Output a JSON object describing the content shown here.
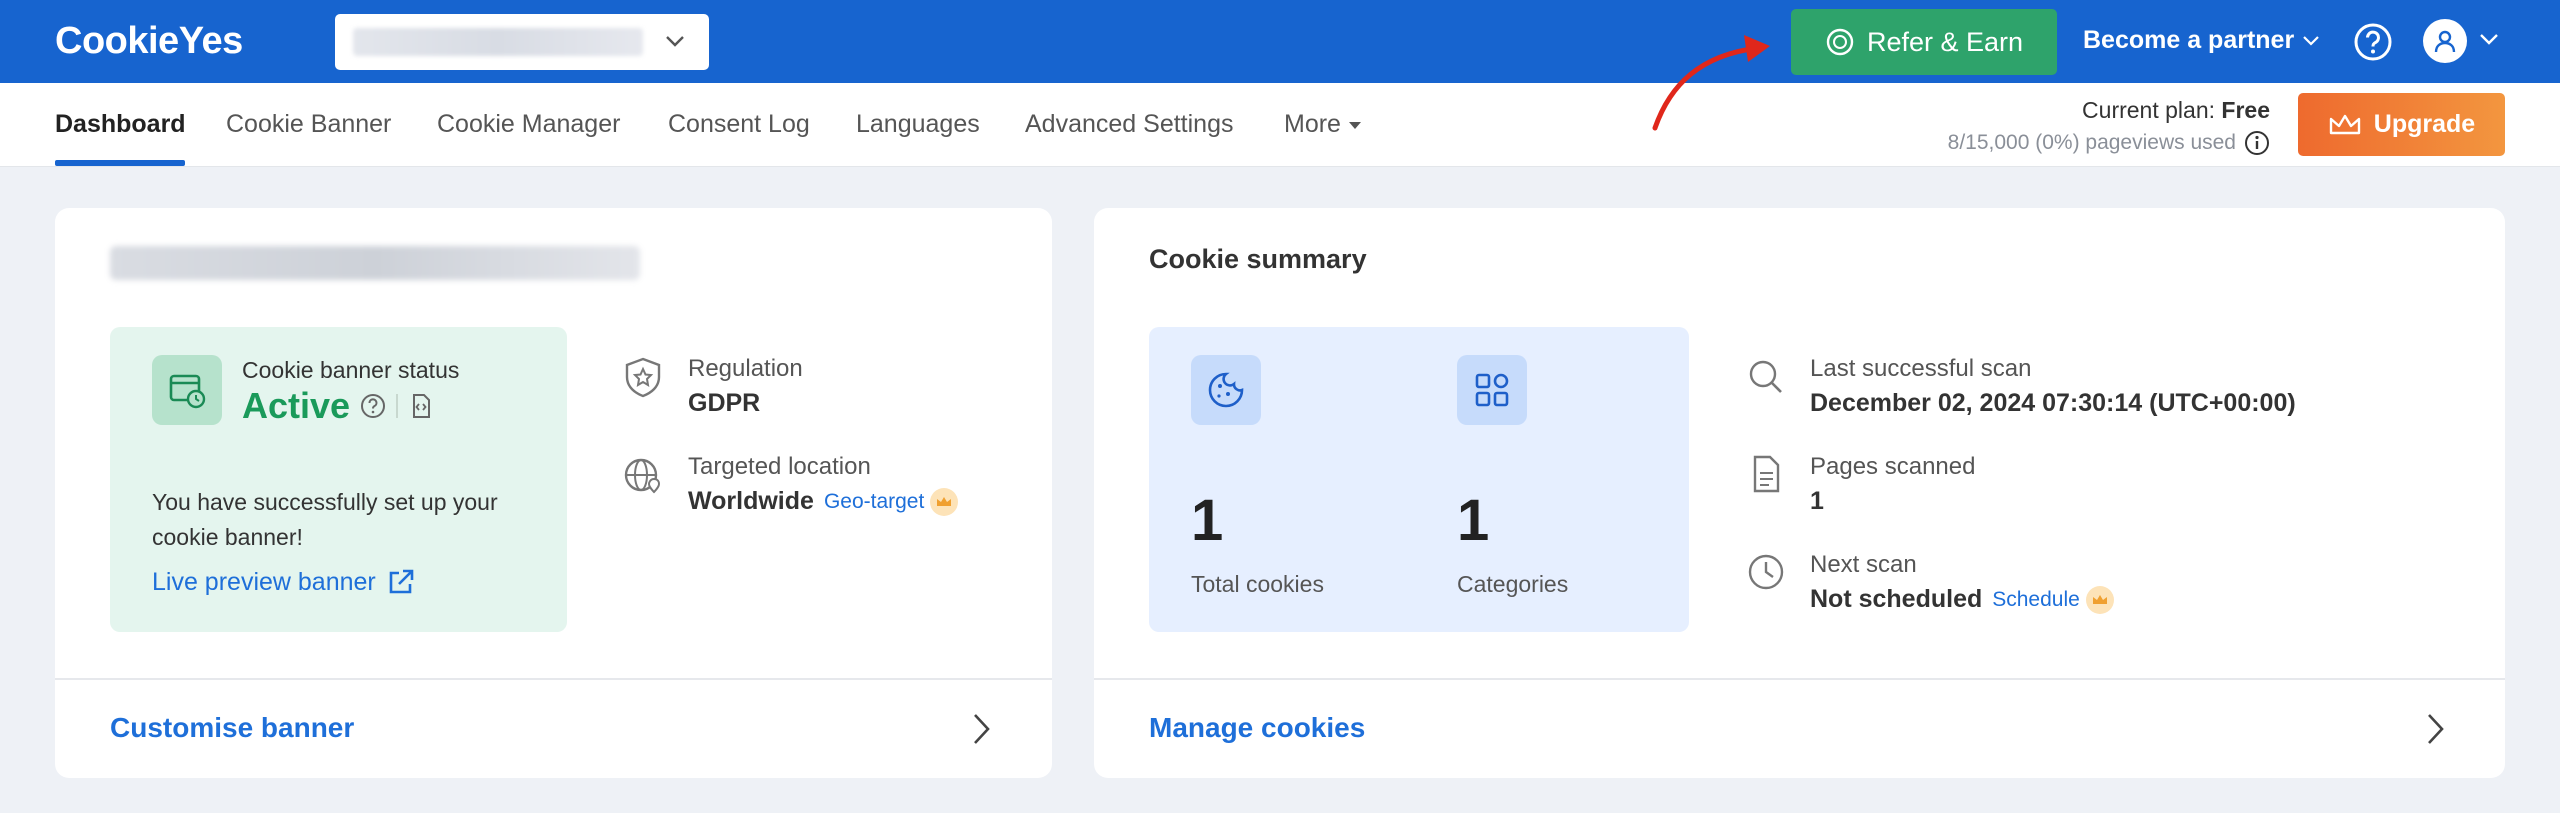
{
  "topbar": {
    "logo": "CookieYes",
    "refer_label": "Refer & Earn",
    "partner_label": "Become a partner"
  },
  "nav": {
    "items": [
      "Dashboard",
      "Cookie Banner",
      "Cookie Manager",
      "Consent Log",
      "Languages",
      "Advanced Settings",
      "More"
    ],
    "active": "Dashboard"
  },
  "plan": {
    "label": "Current plan: ",
    "name": "Free",
    "usage": "8/15,000 (0%) pageviews used"
  },
  "upgrade_label": "Upgrade",
  "banner_card": {
    "status_label": "Cookie banner status",
    "status_value": "Active",
    "message": "You have successfully set up your cookie banner!",
    "preview_link": "Live preview banner",
    "regulation_label": "Regulation",
    "regulation_value": "GDPR",
    "location_label": "Targeted location",
    "location_value": "Worldwide",
    "geo_target_link": "Geo-target",
    "footer_link": "Customise banner"
  },
  "summary_card": {
    "title": "Cookie summary",
    "total_cookies_value": "1",
    "total_cookies_label": "Total cookies",
    "categories_value": "1",
    "categories_label": "Categories",
    "last_scan_label": "Last successful scan",
    "last_scan_value": "December 02, 2024 07:30:14  (UTC+00:00)",
    "pages_scanned_label": "Pages scanned",
    "pages_scanned_value": "1",
    "next_scan_label": "Next scan",
    "next_scan_value": "Not scheduled",
    "schedule_link": "Schedule",
    "footer_link": "Manage cookies"
  },
  "colors": {
    "topbar": "#1764cf",
    "refer_button": "#2ea36b",
    "upgrade_button": "#ee6a2e",
    "active_status": "#1a9a5a",
    "link": "#1e6fd9"
  }
}
